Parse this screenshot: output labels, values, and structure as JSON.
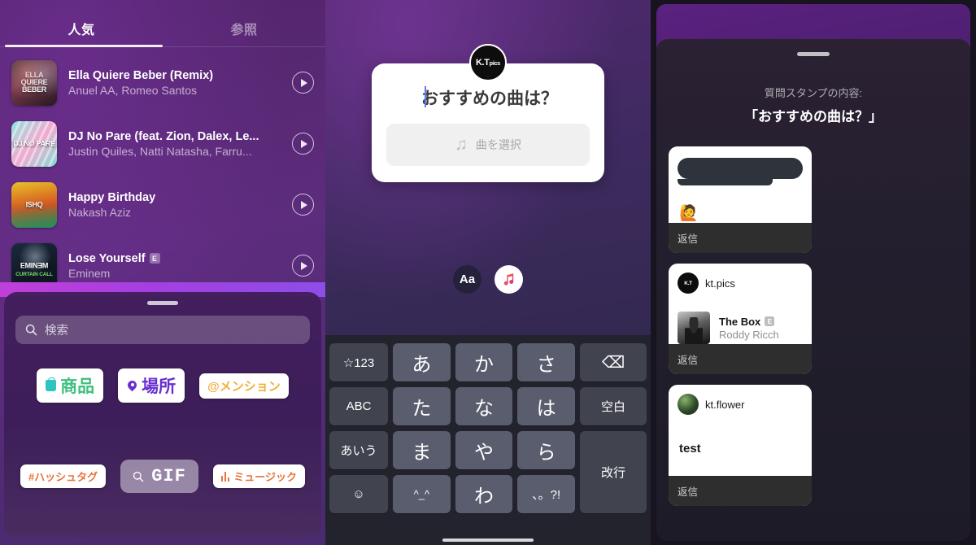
{
  "panel_music": {
    "tabs": [
      {
        "label": "人気",
        "active": true
      },
      {
        "label": "参照",
        "active": false
      }
    ],
    "tracks": [
      {
        "title": "Ella Quiere Beber (Remix)",
        "artist": "Anuel AA, Romeo Santos",
        "explicit": "",
        "art_text": "ELLA QUIERE BEBER",
        "art_class": "art1"
      },
      {
        "title": "DJ No Pare (feat. Zion, Dalex, Le...",
        "artist": "Justin Quiles, Natti Natasha, Farru...",
        "explicit": "",
        "art_text": "DJ NO PARE",
        "art_class": "art2"
      },
      {
        "title": "Happy Birthday",
        "artist": "Nakash Aziz",
        "explicit": "",
        "art_text": "ISHQ",
        "art_class": "art3"
      },
      {
        "title": "Lose Yourself",
        "artist": "Eminem",
        "explicit": "E",
        "art_text": "EMINƎM",
        "art_sub": "CURTAIN CALL",
        "art_class": "art4"
      }
    ],
    "play_icon": "play-icon",
    "sheet": {
      "search_placeholder": "検索",
      "search_icon": "search-icon",
      "grabber": "drag-handle",
      "stickers_row1": [
        {
          "label": "商品",
          "icon": "shopping-bag-icon",
          "color": "#3fbf7f"
        },
        {
          "label": "場所",
          "icon": "location-pin-icon",
          "color": "#6a2fd0"
        },
        {
          "label": "@メンション",
          "icon": "at-icon",
          "color": "#f0b13c"
        }
      ],
      "stickers_row2": [
        {
          "label": "#ハッシュタグ",
          "icon": "hashtag-icon",
          "color": "#e8743b"
        },
        {
          "label": "GIF",
          "icon": "search-icon",
          "color": "#ffffff"
        },
        {
          "label": "ミュージック",
          "icon": "equalizer-icon",
          "color": "#e8743b"
        }
      ]
    }
  },
  "panel_compose": {
    "avatar_top": "K.T",
    "avatar_bottom": "pics",
    "question_text": "おすすめの曲は？",
    "song_picker_label": "曲を選択",
    "song_picker_icon": "music-note-icon",
    "mode_text_label": "Aa",
    "mode_music_icon": "music-note-icon",
    "keyboard": {
      "rows": [
        [
          "☆123",
          "あ",
          "か",
          "さ",
          "⌫"
        ],
        [
          "ABC",
          "た",
          "な",
          "は",
          "空白"
        ],
        [
          "あいう",
          "ま",
          "や",
          "ら",
          "改行"
        ],
        [
          "☺",
          "^_^",
          "わ",
          "、。?!",
          ""
        ]
      ]
    }
  },
  "panel_responses": {
    "subtitle": "質問スタンプの内容:",
    "title": "「おすすめの曲は？」",
    "grabber": "drag-handle",
    "cards": [
      {
        "type": "redacted",
        "username": "",
        "emoji": "🙋",
        "reply_label": "返信"
      },
      {
        "type": "song",
        "username": "kt.pics",
        "avatar_top": "K.T",
        "avatar_bottom": "pics",
        "song_title": "The Box",
        "song_artist": "Roddy Ricch",
        "explicit": "E",
        "reply_label": "返信"
      },
      {
        "type": "text",
        "username": "kt.flower",
        "text": "test",
        "reply_label": "返信"
      }
    ]
  }
}
